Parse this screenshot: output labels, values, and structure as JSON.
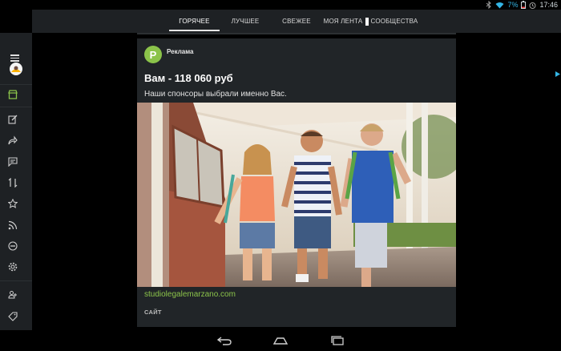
{
  "status": {
    "battery": "7%",
    "time": "17:46"
  },
  "tabs": [
    {
      "label": "ГОРЯЧЕЕ",
      "active": true
    },
    {
      "label": "ЛУЧШЕЕ",
      "active": false
    },
    {
      "label": "СВЕЖЕЕ",
      "active": false
    },
    {
      "label": "МОЯ ЛЕНТА",
      "active": false
    },
    {
      "label": "СООБЩЕСТВА",
      "active": false
    }
  ],
  "sidebar": {
    "icons": [
      "shop-icon",
      "edit-icon",
      "share-icon",
      "comment-icon",
      "sort-icon",
      "star-icon",
      "rss-icon",
      "minus-circle-icon",
      "settings-icon",
      "users-icon",
      "tag-icon"
    ]
  },
  "ad": {
    "avatar_letter": "P",
    "label": "Реклама",
    "title": "Вам - 118 060 руб",
    "description": "Наши спонсоры выбрали именно Вас.",
    "link": "studiolegalemarzano.com",
    "cta": "САЙТ"
  },
  "colors": {
    "accent": "#8bc34a",
    "status_blue": "#33b5e5",
    "panel": "#1e2124",
    "card": "#212528"
  }
}
